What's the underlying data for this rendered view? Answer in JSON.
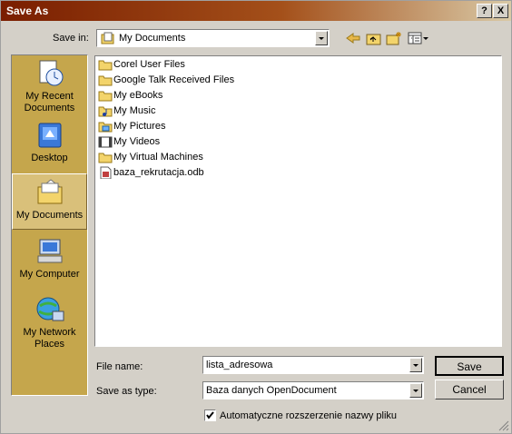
{
  "window": {
    "title": "Save As",
    "help_btn": "?",
    "close_btn": "X"
  },
  "toolbar": {
    "save_in_label": "Save in:",
    "save_in_value": "My Documents"
  },
  "places": [
    {
      "name": "recent",
      "label": "My Recent Documents",
      "icon": "recent-documents-icon"
    },
    {
      "name": "desktop",
      "label": "Desktop",
      "icon": "desktop-icon"
    },
    {
      "name": "my-documents",
      "label": "My Documents",
      "icon": "my-documents-icon"
    },
    {
      "name": "my-computer",
      "label": "My Computer",
      "icon": "my-computer-icon"
    },
    {
      "name": "network",
      "label": "My Network Places",
      "icon": "network-places-icon"
    }
  ],
  "files": [
    {
      "name": "Corel User Files",
      "icon": "folder-icon"
    },
    {
      "name": "Google Talk Received Files",
      "icon": "folder-icon"
    },
    {
      "name": "My eBooks",
      "icon": "folder-icon"
    },
    {
      "name": "My Music",
      "icon": "music-folder-icon"
    },
    {
      "name": "My Pictures",
      "icon": "pictures-folder-icon"
    },
    {
      "name": "My Videos",
      "icon": "videos-folder-icon"
    },
    {
      "name": "My Virtual Machines",
      "icon": "folder-icon"
    },
    {
      "name": "baza_rekrutacja.odb",
      "icon": "odb-file-icon"
    }
  ],
  "form": {
    "file_name_label": "File name:",
    "file_name_value": "lista_adresowa",
    "save_type_label": "Save as type:",
    "save_type_value": "Baza danych OpenDocument",
    "auto_ext_label": "Automatyczne rozszerzenie nazwy pliku",
    "auto_ext_checked": true
  },
  "buttons": {
    "save": "Save",
    "cancel": "Cancel"
  },
  "colors": {
    "title_start": "#7a1e00",
    "places_bg": "#c5a64c",
    "dialog_bg": "#d4d0c8"
  }
}
